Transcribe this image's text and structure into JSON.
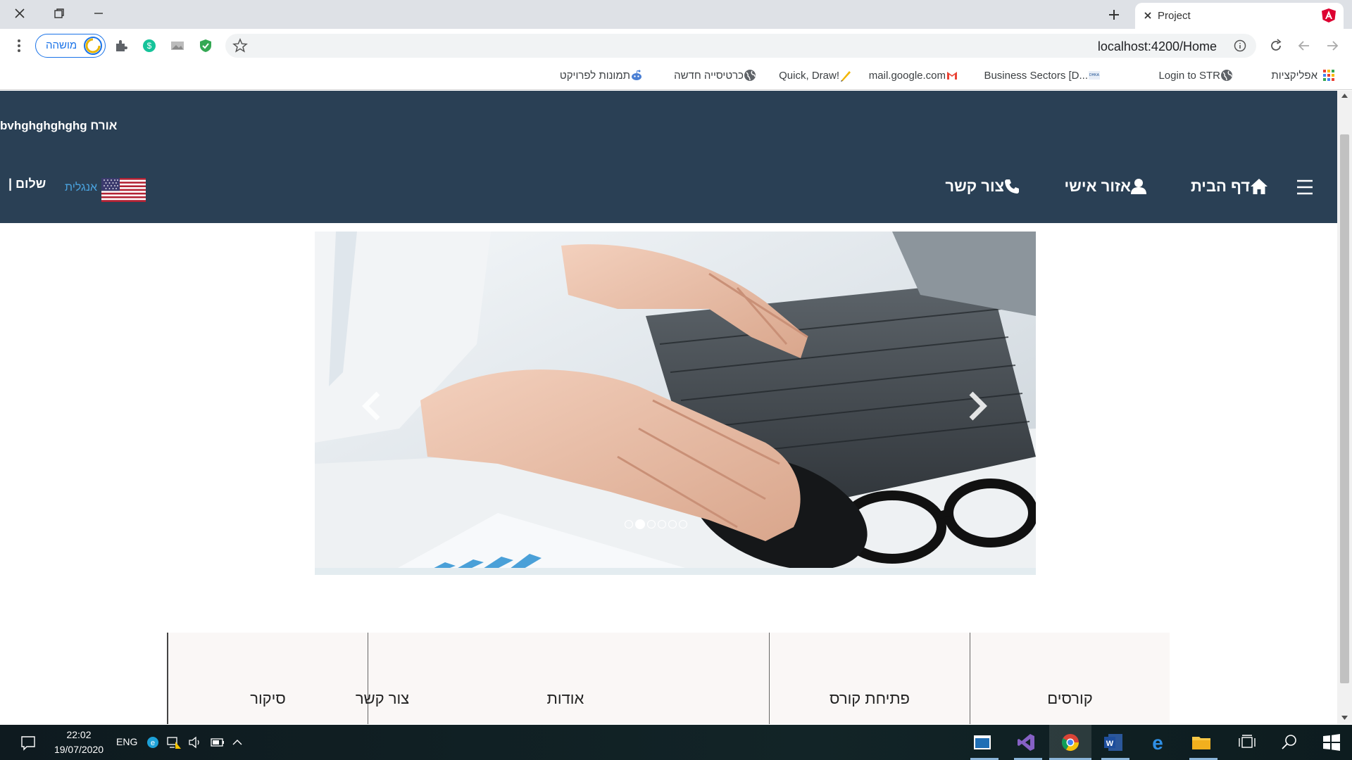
{
  "browser": {
    "tab_title": "Project",
    "url": "localhost:4200/Home",
    "profile_label": "מושהה",
    "bookmarks": [
      {
        "label": "אפליקציות",
        "icon": "apps-grid-icon"
      },
      {
        "label": "Login to STR",
        "icon": "globe-icon"
      },
      {
        "label": "Business Sectors [D...",
        "icon": "dhka-icon"
      },
      {
        "label": "mail.google.com",
        "icon": "gmail-icon"
      },
      {
        "label": "Quick, Draw!",
        "icon": "quickdraw-icon"
      },
      {
        "label": "כרטיסייה חדשה",
        "icon": "globe-icon"
      },
      {
        "label": "תמונות לפרויקט",
        "icon": "reddit-icon"
      }
    ]
  },
  "navbar": {
    "username": "bvhghghghghg אורח",
    "items": [
      {
        "label": "דף הבית",
        "icon": "home-icon"
      },
      {
        "label": "אזור אישי",
        "icon": "user-icon"
      },
      {
        "label": "צור קשר",
        "icon": "phone-icon"
      }
    ],
    "language": "אנגלית",
    "greeting": "| שלום"
  },
  "carousel": {
    "slide_count": 6,
    "active_index": 1
  },
  "menu": {
    "items": [
      "קורסים",
      "פתיחת קורס",
      "אודות",
      "צור קשר",
      "סיקור"
    ]
  },
  "taskbar": {
    "time": "22:02",
    "date": "19/07/2020",
    "lang": "ENG"
  },
  "colors": {
    "navbar": "#2a4055",
    "language_link": "#4aa3df",
    "menu_bg": "#faf7f6"
  }
}
